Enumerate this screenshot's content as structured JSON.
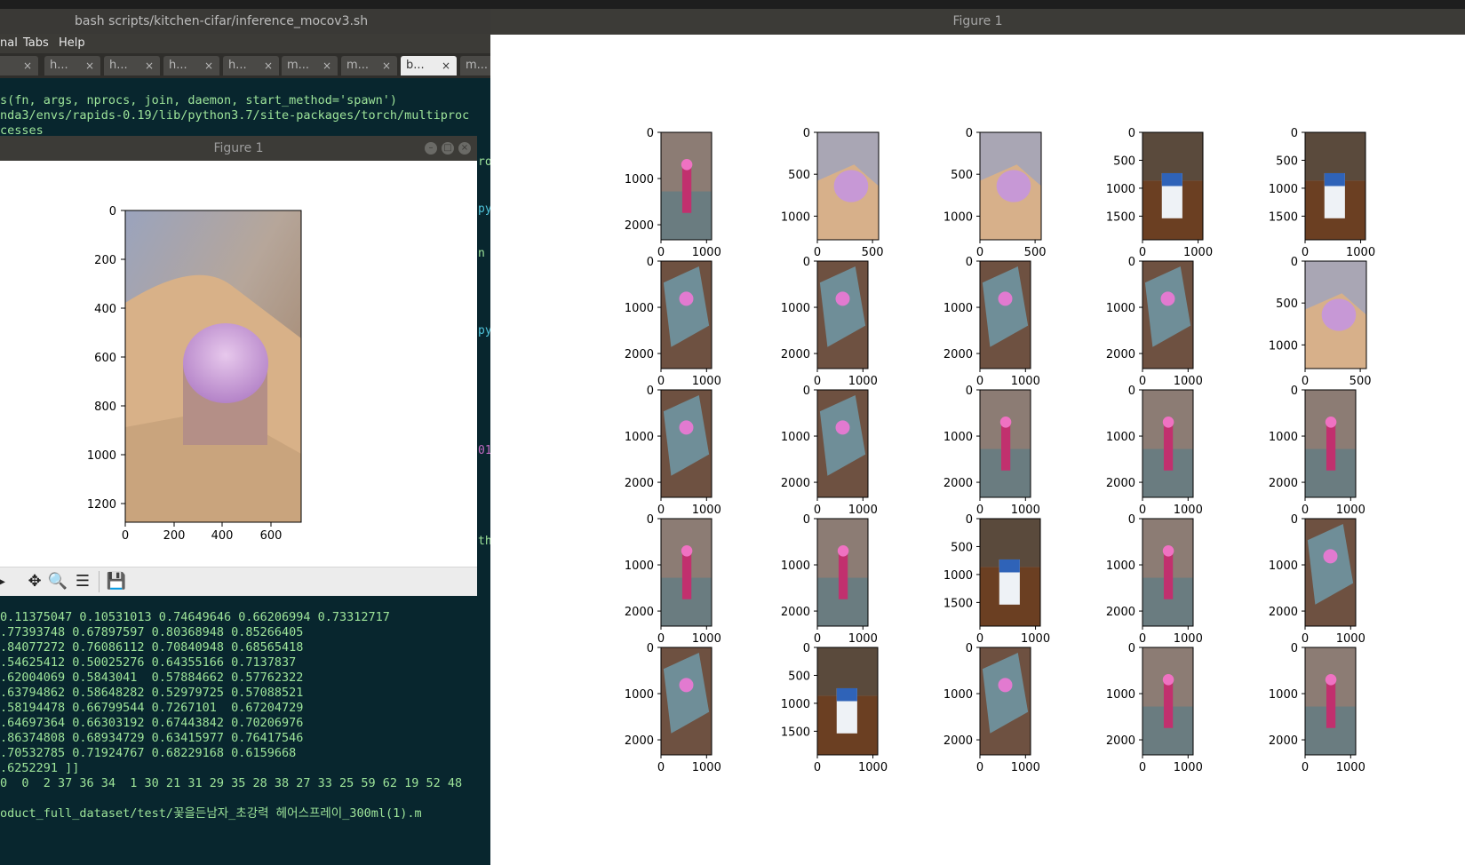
{
  "terminal": {
    "window_title": "bash scripts/kitchen-cifar/inference_mocov3.sh",
    "menu": [
      "nal",
      "Tabs",
      "Help"
    ],
    "tabs": [
      "",
      "h...",
      "h...",
      "h...",
      "h...",
      "m...",
      "m...",
      "b...",
      "m..."
    ],
    "active_tab": 7,
    "tab_close": "×",
    "top_lines": [
      "s(fn, args, nprocs, join, daemon, start_method='spawn')",
      "nda3/envs/rapids-0.19/lib/python3.7/site-packages/torch/multiproc",
      "cesses"
    ],
    "side_fragments": [
      "roc",
      "py",
      "n s",
      "py",
      "01",
      "th."
    ],
    "bottom_lines": [
      "0.11375047 0.10531013 0.74649646 0.66206994 0.73312717",
      ".77393748 0.67897597 0.80368948 0.85266405",
      ".84077272 0.76086112 0.70840948 0.68565418",
      ".54625412 0.50025276 0.64355166 0.7137837",
      ".62004069 0.5843041  0.57884662 0.57762322",
      ".63794862 0.58648282 0.52979725 0.57088521",
      ".58194478 0.66799544 0.7267101  0.67204729",
      ".64697364 0.66303192 0.67443842 0.70206976",
      ".86374808 0.68934729 0.63415977 0.76417546",
      ".70532785 0.71924767 0.68229168 0.6159668",
      ".6252291 ]]",
      "0  0  2 37 36 34  1 30 21 31 29 35 28 38 27 33 25 59 62 19 52 48",
      "",
      "oduct_full_dataset/test/꽃을든남자_초강력 헤어스프레이_300ml(1).m"
    ]
  },
  "small_figure": {
    "title": "Figure 1",
    "yticks": [
      "0",
      "200",
      "400",
      "600",
      "800",
      "1000",
      "1200"
    ],
    "xticks": [
      "0",
      "200",
      "400",
      "600"
    ],
    "toolbar_icons": [
      "forward-icon",
      "pan-icon",
      "zoom-icon",
      "configure-icon",
      "save-icon"
    ],
    "toolbar_glyphs": [
      "▶",
      "✥",
      "🔍",
      "☰",
      "💾"
    ]
  },
  "big_figure": {
    "title": "Figure 1",
    "panels": [
      {
        "thumb": "spray",
        "xt": [
          "0",
          "1000"
        ],
        "yt": [
          "0",
          "1000",
          "2000"
        ]
      },
      {
        "thumb": "cap",
        "xt": [
          "0",
          "500"
        ],
        "yt": [
          "0",
          "500",
          "1000"
        ]
      },
      {
        "thumb": "cap",
        "xt": [
          "0",
          "500"
        ],
        "yt": [
          "0",
          "500",
          "1000"
        ]
      },
      {
        "thumb": "milk",
        "xt": [
          "0",
          "1000"
        ],
        "yt": [
          "0",
          "500",
          "1000",
          "1500"
        ]
      },
      {
        "thumb": "milk",
        "xt": [
          "0",
          "1000"
        ],
        "yt": [
          "0",
          "500",
          "1000",
          "1500"
        ]
      },
      {
        "thumb": "crate",
        "xt": [
          "0",
          "1000"
        ],
        "yt": [
          "0",
          "1000",
          "2000"
        ]
      },
      {
        "thumb": "crate",
        "xt": [
          "0",
          "1000"
        ],
        "yt": [
          "0",
          "1000",
          "2000"
        ]
      },
      {
        "thumb": "crate",
        "xt": [
          "0",
          "1000"
        ],
        "yt": [
          "0",
          "1000",
          "2000"
        ]
      },
      {
        "thumb": "crate",
        "xt": [
          "0",
          "1000"
        ],
        "yt": [
          "0",
          "1000",
          "2000"
        ]
      },
      {
        "thumb": "cap",
        "xt": [
          "0",
          "500"
        ],
        "yt": [
          "0",
          "500",
          "1000"
        ]
      },
      {
        "thumb": "crate",
        "xt": [
          "0",
          "1000"
        ],
        "yt": [
          "0",
          "1000",
          "2000"
        ]
      },
      {
        "thumb": "crate",
        "xt": [
          "0",
          "1000"
        ],
        "yt": [
          "0",
          "1000",
          "2000"
        ]
      },
      {
        "thumb": "spray",
        "xt": [
          "0",
          "1000"
        ],
        "yt": [
          "0",
          "1000",
          "2000"
        ]
      },
      {
        "thumb": "spray",
        "xt": [
          "0",
          "1000"
        ],
        "yt": [
          "0",
          "1000",
          "2000"
        ]
      },
      {
        "thumb": "spray",
        "xt": [
          "0",
          "1000"
        ],
        "yt": [
          "0",
          "1000",
          "2000"
        ]
      },
      {
        "thumb": "spray",
        "xt": [
          "0",
          "1000"
        ],
        "yt": [
          "0",
          "1000",
          "2000"
        ]
      },
      {
        "thumb": "spray",
        "xt": [
          "0",
          "1000"
        ],
        "yt": [
          "0",
          "1000",
          "2000"
        ]
      },
      {
        "thumb": "milk",
        "xt": [
          "0",
          "1000"
        ],
        "yt": [
          "0",
          "500",
          "1000",
          "1500"
        ]
      },
      {
        "thumb": "spray",
        "xt": [
          "0",
          "1000"
        ],
        "yt": [
          "0",
          "1000",
          "2000"
        ]
      },
      {
        "thumb": "crate",
        "xt": [
          "0",
          "1000"
        ],
        "yt": [
          "0",
          "1000",
          "2000"
        ]
      },
      {
        "thumb": "crate",
        "xt": [
          "0",
          "1000"
        ],
        "yt": [
          "0",
          "1000",
          "2000"
        ]
      },
      {
        "thumb": "milk",
        "xt": [
          "0",
          "1000"
        ],
        "yt": [
          "0",
          "500",
          "1000",
          "1500"
        ]
      },
      {
        "thumb": "crate",
        "xt": [
          "0",
          "1000"
        ],
        "yt": [
          "0",
          "1000",
          "2000"
        ]
      },
      {
        "thumb": "spray",
        "xt": [
          "0",
          "1000"
        ],
        "yt": [
          "0",
          "1000",
          "2000"
        ]
      },
      {
        "thumb": "spray",
        "xt": [
          "0",
          "1000"
        ],
        "yt": [
          "0",
          "1000",
          "2000"
        ]
      }
    ]
  },
  "colors": {
    "terminal_bg": "#08262e",
    "terminal_text": "#9ee59a",
    "titlebar": "#3c3b37",
    "magenta": "#c36ac3",
    "cyan": "#4fc3d9"
  }
}
